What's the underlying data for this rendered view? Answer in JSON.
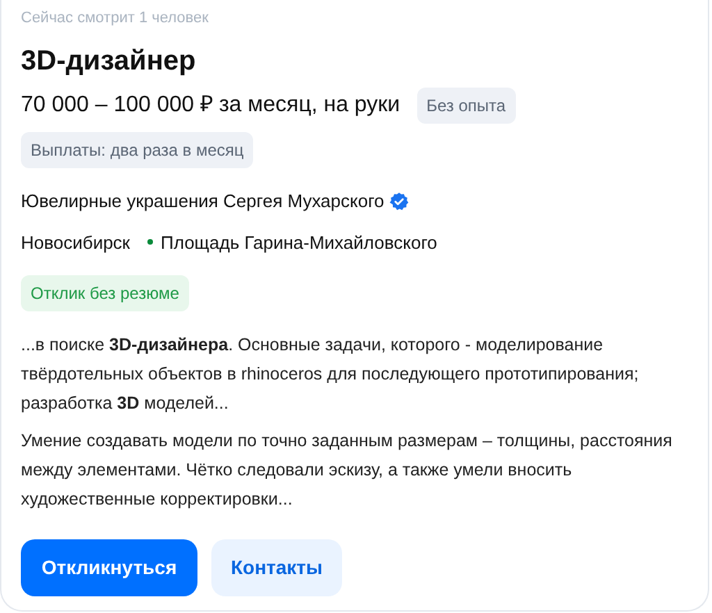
{
  "viewers": "Сейчас смотрит 1 человек",
  "title": "3D-дизайнер",
  "salary": "70 000 – 100 000 ₽ за месяц, на руки",
  "experience_tag": "Без опыта",
  "payout_tag": "Выплаты: два раза в месяц",
  "company": {
    "name": "Ювелирные украшения Сергея Мухарского",
    "verified": true
  },
  "location": {
    "city": "Новосибирск",
    "metro": {
      "name": "Площадь Гарина-Михайловского",
      "color": "#0a8a3a"
    }
  },
  "response_tag": "Отклик без резюме",
  "snippets": [
    "...в поиске **3D-дизайнера**. Основные задачи, которого - моделирование твёрдотельных объектов в rhinoceros для последующего прототипирования; разработка **3D** моделей...",
    "Умение создавать модели по точно заданным размерам – толщины, расстояния между элементами. Чётко следовали эскизу, а также умели вносить художественные корректировки..."
  ],
  "buttons": [
    {
      "label": "Откликнуться",
      "kind": "primary"
    },
    {
      "label": "Контакты",
      "kind": "secondary"
    }
  ]
}
